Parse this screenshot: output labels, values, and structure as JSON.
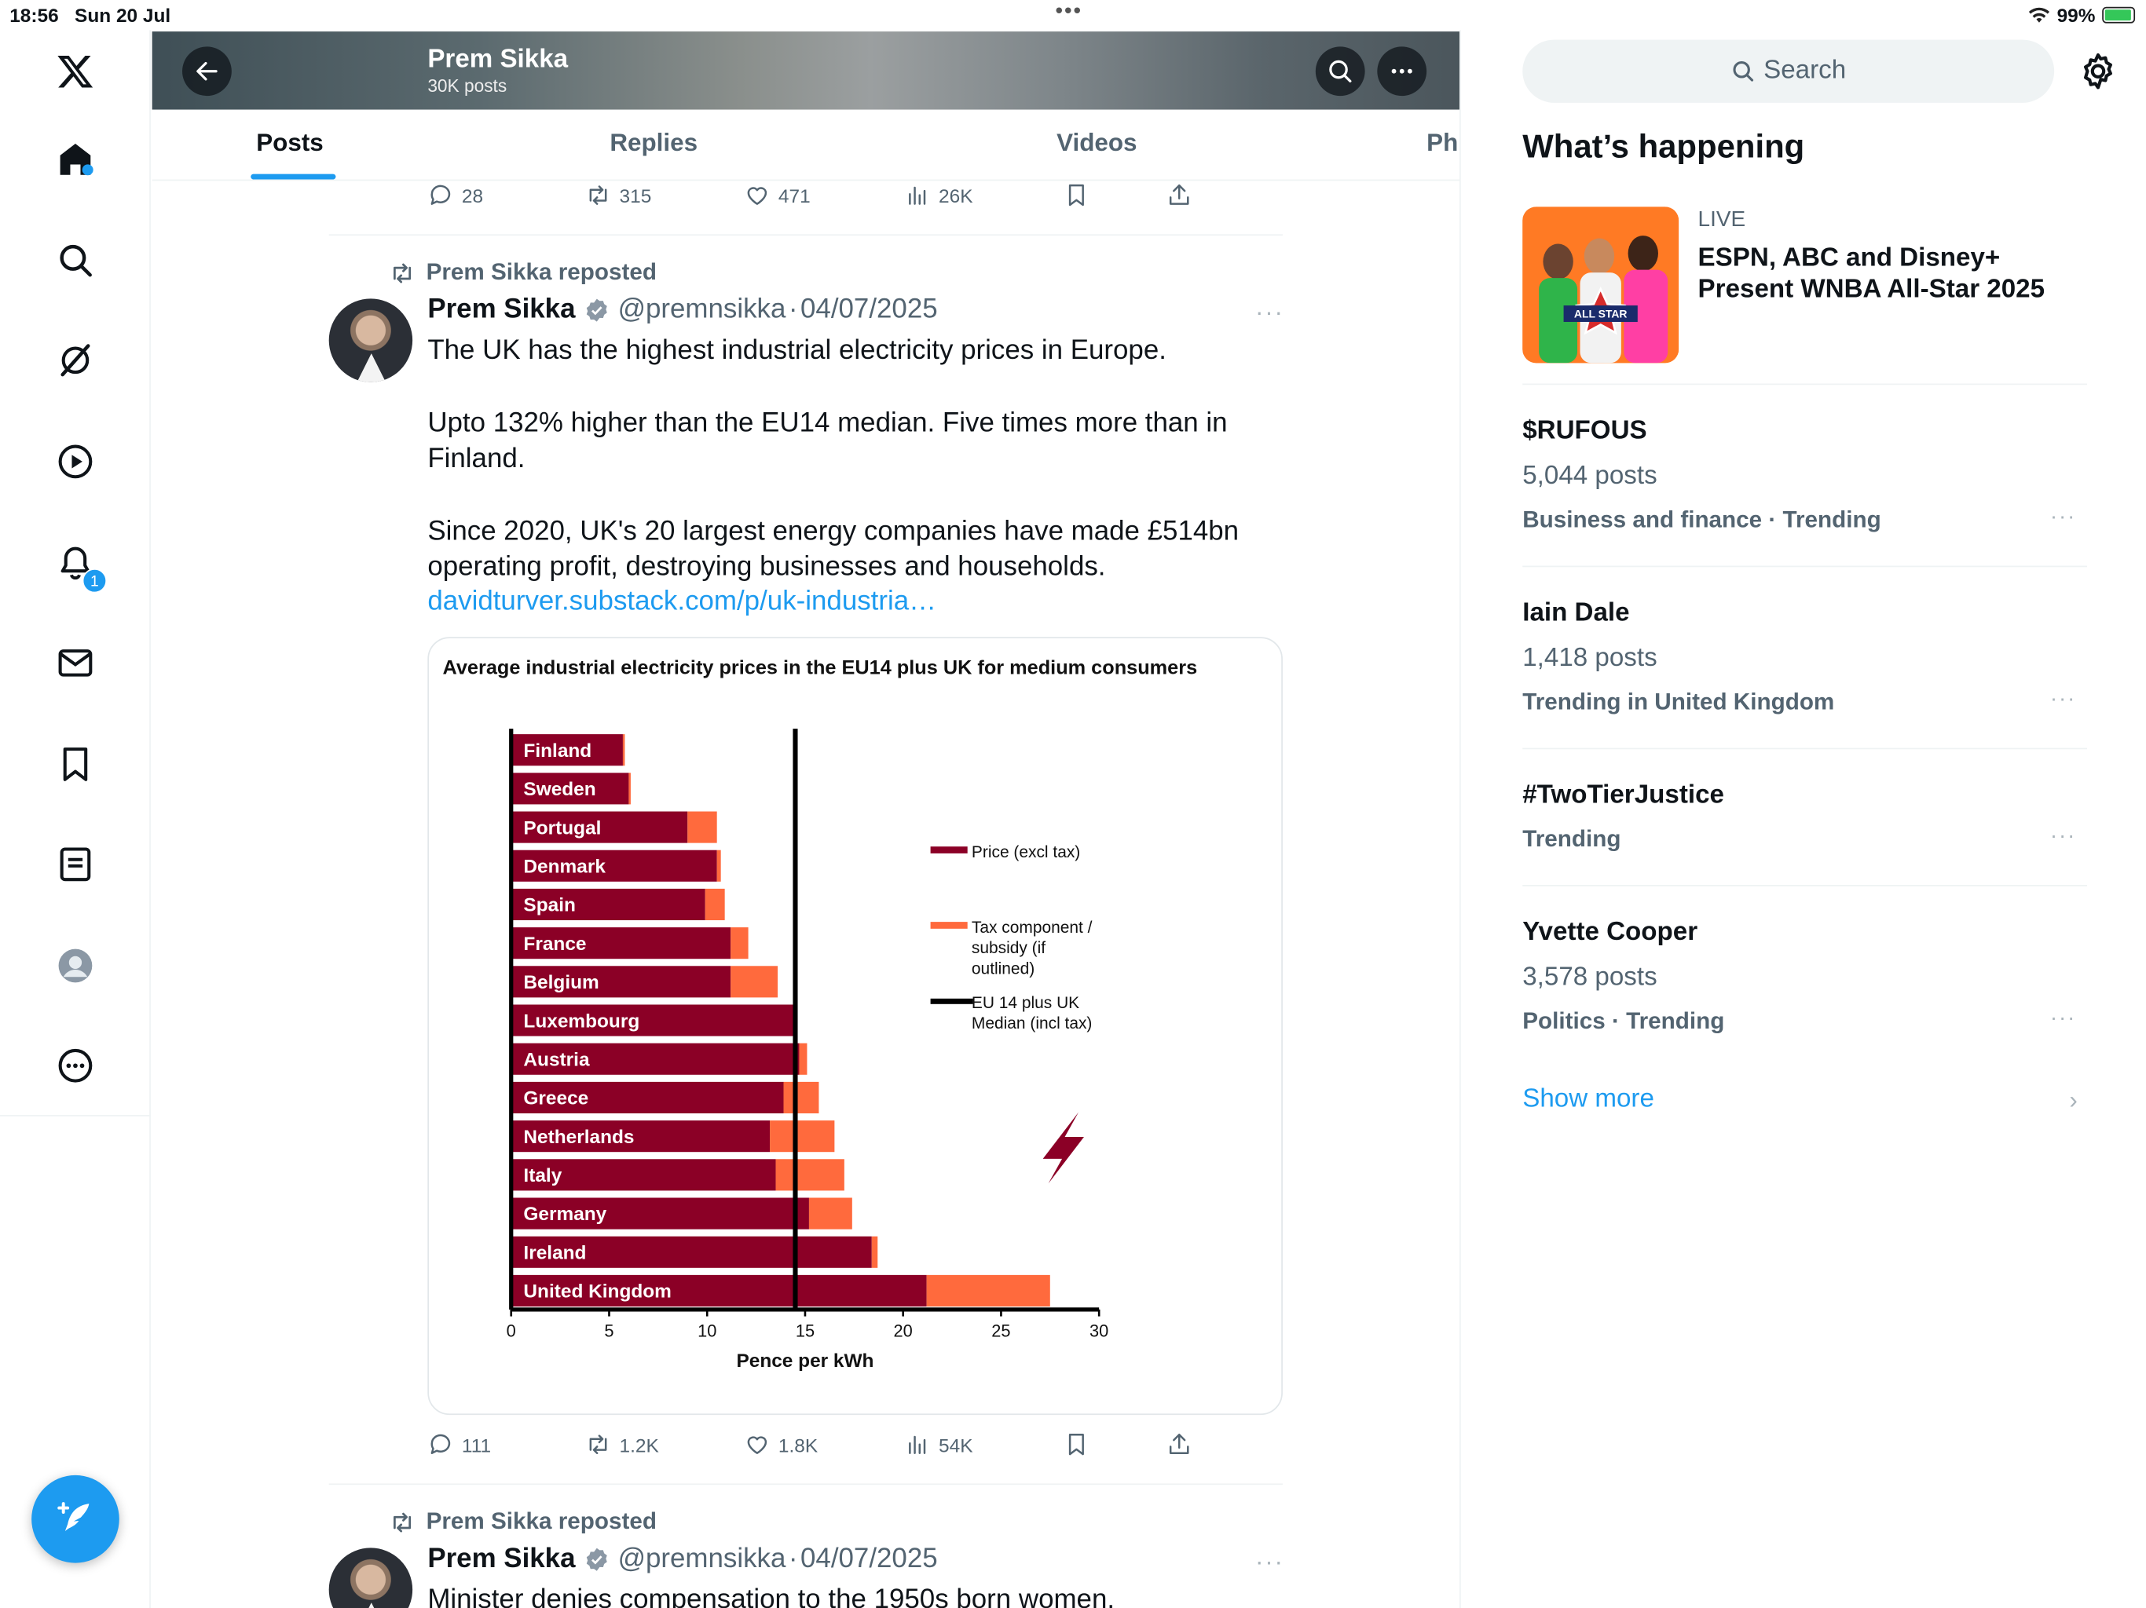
{
  "status_bar": {
    "time": "18:56",
    "date": "Sun 20 Jul",
    "battery": "99%",
    "dots": "•••"
  },
  "nav": {
    "notification_count": "1"
  },
  "profile": {
    "name": "Prem Sikka",
    "post_count": "30K posts"
  },
  "tabs": [
    {
      "label": "Posts"
    },
    {
      "label": "Replies"
    },
    {
      "label": "Videos"
    },
    {
      "label": "Ph"
    }
  ],
  "prev_post_actions": {
    "replies": "28",
    "reposts": "315",
    "likes": "471",
    "views": "26K"
  },
  "post1": {
    "repost_label": "Prem Sikka reposted",
    "name": "Prem Sikka",
    "handle": "@premnsikka",
    "separator": "·",
    "date": "04/07/2025",
    "more": "···",
    "paragraph1": "The UK has the highest industrial electricity prices in Europe.",
    "paragraph2_line1": "Upto 132% higher than the EU14 median. Five times more than in",
    "paragraph2_line2": "Finland.",
    "paragraph3_line1": "Since 2020, UK's 20 largest energy companies have made £514bn",
    "paragraph3_line2": "operating profit, destroying businesses and households.",
    "link": "davidturver.substack.com/p/uk-industria…",
    "actions": {
      "replies": "111",
      "reposts": "1.2K",
      "likes": "1.8K",
      "views": "54K"
    }
  },
  "chart_data": {
    "type": "bar",
    "orientation": "horizontal",
    "stacked": true,
    "title": "Average industrial electricity prices in the EU14 plus UK for medium consumers",
    "xlabel": "Pence per kWh",
    "ylabel": "",
    "xlim": [
      0,
      30
    ],
    "xticks": [
      "0",
      "5",
      "10",
      "15",
      "20",
      "25",
      "30"
    ],
    "categories": [
      "Finland",
      "Sweden",
      "Portugal",
      "Denmark",
      "Spain",
      "France",
      "Belgium",
      "Luxembourg",
      "Austria",
      "Greece",
      "Netherlands",
      "Italy",
      "Germany",
      "Ireland",
      "United Kingdom"
    ],
    "series": [
      {
        "name": "Price (excl tax)",
        "color": "#8b0026",
        "values": [
          5.7,
          6.0,
          9.0,
          10.5,
          9.9,
          11.2,
          11.2,
          14.5,
          14.7,
          13.9,
          13.2,
          13.5,
          15.2,
          18.4,
          21.2
        ]
      },
      {
        "name": "Tax component / subsidy (if outlined)",
        "color": "#ff6a3d",
        "values": [
          0.1,
          0.1,
          1.5,
          0.2,
          1.0,
          0.9,
          2.4,
          0.0,
          0.4,
          1.8,
          3.3,
          3.5,
          2.2,
          0.3,
          6.3
        ]
      }
    ],
    "median": {
      "name": "EU 14 plus UK Median (incl tax)",
      "value": 14.5
    },
    "legend": [
      "Price (excl tax)",
      "Tax component / subsidy (if outlined)",
      "EU 14 plus UK Median (incl tax)"
    ],
    "legend_lines": {
      "price": [
        "Price (excl tax)"
      ],
      "tax": [
        "Tax component /",
        "subsidy (if",
        "outlined)"
      ],
      "median": [
        "EU 14 plus UK",
        "Median (incl tax)"
      ]
    },
    "legend_position": "right",
    "grid": false
  },
  "post2": {
    "repost_label": "Prem Sikka reposted",
    "name": "Prem Sikka",
    "handle": "@premnsikka",
    "separator": "·",
    "date": "04/07/2025",
    "more": "···",
    "text": "Minister denies compensation to the 1950s born women."
  },
  "sidebar": {
    "search_placeholder": "Search",
    "whats_happening": "What’s happening",
    "live": {
      "label": "LIVE",
      "title": "ESPN, ABC and Disney+ Present WNBA All-Star 2025",
      "thumb_text": "ALL STAR"
    },
    "trends": [
      {
        "title": "$RUFOUS",
        "count": "5,044 posts",
        "category": "Business and finance · Trending"
      },
      {
        "title": "Iain Dale",
        "count": "1,418 posts",
        "category": "Trending in United Kingdom"
      },
      {
        "title": "#TwoTierJustice",
        "count": "",
        "category": "Trending"
      },
      {
        "title": "Yvette Cooper",
        "count": "3,578 posts",
        "category": "Politics · Trending"
      }
    ],
    "more_dots": "···",
    "show_more": "Show more",
    "chevron": "›"
  }
}
